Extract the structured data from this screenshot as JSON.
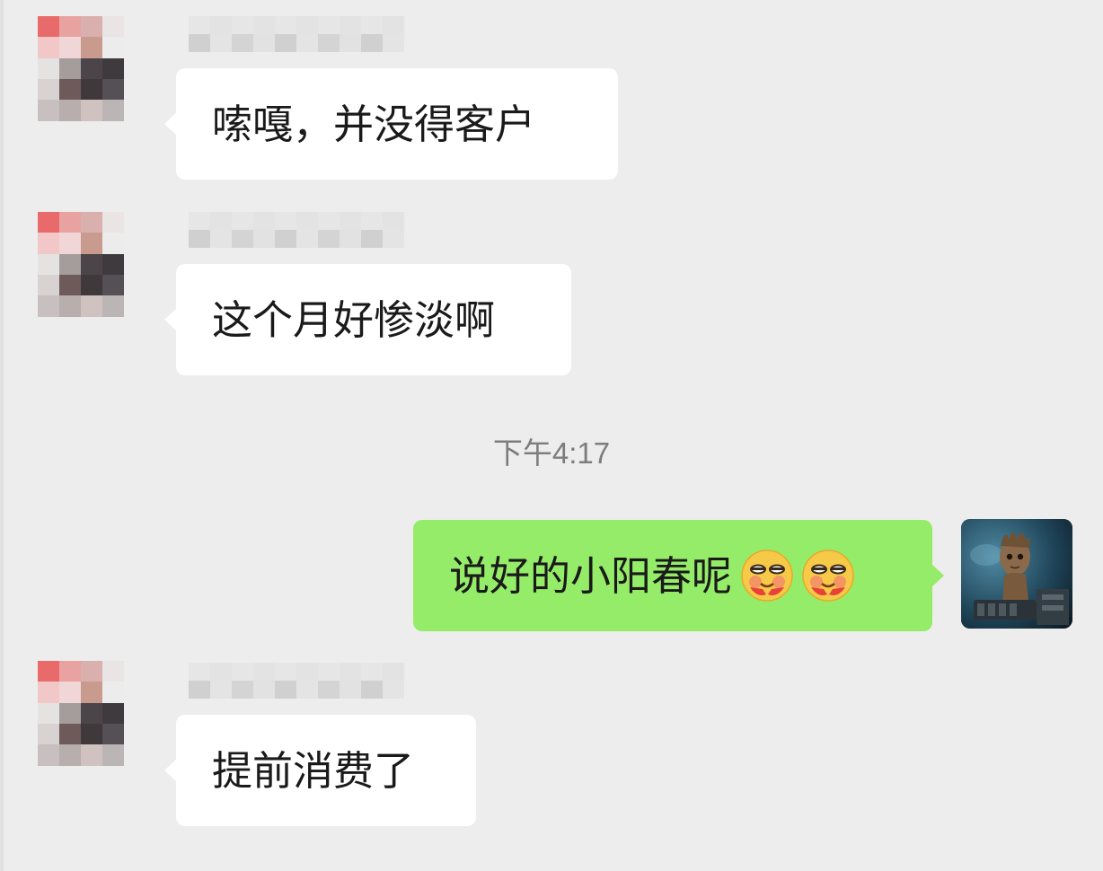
{
  "timestamp": "下午4:17",
  "messages": [
    {
      "sender": "other",
      "text": "嗦嘎，并没得客户"
    },
    {
      "sender": "other",
      "text": "这个月好惨淡啊"
    },
    {
      "sender": "self",
      "text": "说好的小阳春呢",
      "emojis": [
        "smirk-blush-emoji",
        "smirk-blush-emoji"
      ]
    },
    {
      "sender": "other",
      "text": "提前消费了"
    }
  ],
  "colors": {
    "background": "#ededed",
    "incoming_bubble": "#ffffff",
    "outgoing_bubble": "#95ec69",
    "timestamp_text": "#7d7d7d"
  }
}
